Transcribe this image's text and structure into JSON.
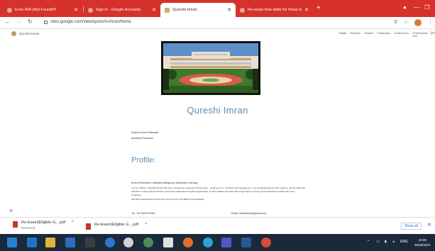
{
  "browser": {
    "tabs": [
      {
        "label": "Error 404 (Not Found)!!!",
        "active": false
      },
      {
        "label": "Sign in - Google Accounts",
        "active": false
      },
      {
        "label": "Qureshi Imran",
        "active": true
      },
      {
        "label": "Re-exam time table for those w",
        "active": false
      }
    ],
    "url": "sites.google.com/view/qureshi-imran/home",
    "accent_color": "#d6312a"
  },
  "site": {
    "title": "Qureshi Imran",
    "nav": [
      "Home",
      "Students",
      "Student",
      "Publication",
      "Conferences",
      "Professional Ach",
      "B"
    ]
  },
  "content": {
    "heading": "Qureshi Imran",
    "name_line": "Qureshi Imran Pirbasab",
    "designation": "Assistant Professor",
    "profile_heading": "Profile:",
    "area": "Area of Research: Artificial Intelligence &Machine Learning",
    "bio1": "I am an efficient, professional who has been consistently competent working hard – working on cs – numbers and management. I am a dedicated person who wants to use the skills and",
    "bio2": "education to help students achieve using both traditional and modern approaches. To take initiative and work with a high degree of energy and enthusiasm coupled with vision",
    "bio3": "to achieve.",
    "bio4": "skill and organizational growth and to do the best of his ability and knowledge.",
    "tel": "Tel: +91 9021070302",
    "email": "Email: imranitimas@gmail.com"
  },
  "downloads": [
    {
      "name": "Re-Exam(Eligible G....pdf",
      "status": "Removed"
    },
    {
      "name": "Re-Exam(Eligible G....pdf",
      "status": ""
    }
  ],
  "shelf": {
    "show_all": "Show all"
  },
  "taskbar": {
    "lang": "ENG",
    "time": "16:08",
    "date": "30/08/2021"
  }
}
